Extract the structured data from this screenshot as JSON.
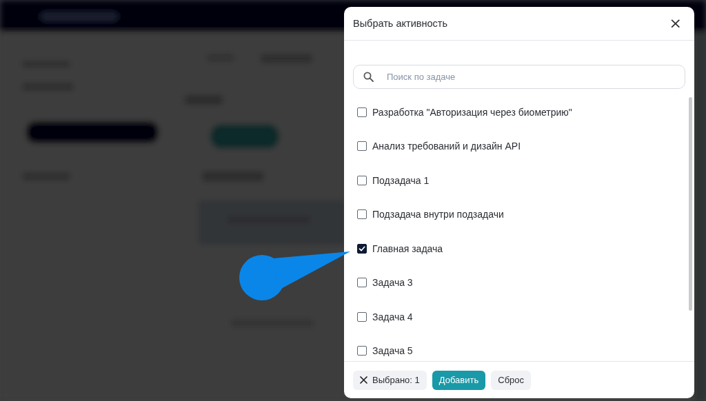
{
  "dialog": {
    "title": "Выбрать активность",
    "close": "×",
    "search": {
      "placeholder": "Поиск по задаче"
    },
    "items": [
      {
        "label": "Разработка \"Авторизация через биометрию\"",
        "checked": false
      },
      {
        "label": "Анализ требований и дизайн API",
        "checked": false
      },
      {
        "label": "Подзадача 1",
        "checked": false
      },
      {
        "label": "Подзадача внутри подзадачи",
        "checked": false
      },
      {
        "label": "Главная задача",
        "checked": true
      },
      {
        "label": "Задача 3",
        "checked": false
      },
      {
        "label": "Задача 4",
        "checked": false
      },
      {
        "label": "Задача 5",
        "checked": false
      }
    ],
    "footer": {
      "selected_count": "Выбрано: 1",
      "add_button": "Добавить",
      "reset_button": "Сброс"
    }
  }
}
